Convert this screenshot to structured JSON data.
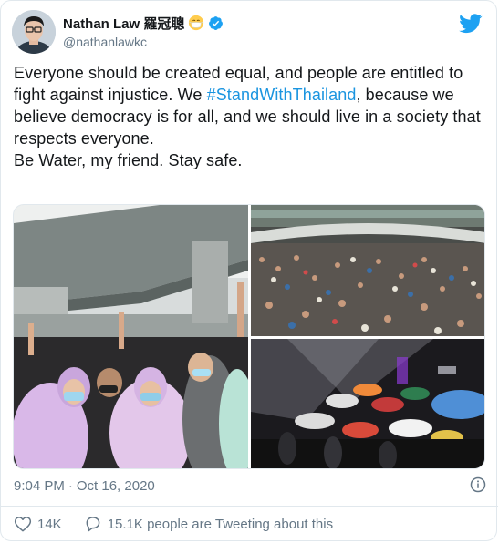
{
  "author": {
    "display_name": "Nathan Law 羅冠聰",
    "handle": "@nathanlawkc",
    "emoji_icon": "mask-face-emoji-icon",
    "verified_icon": "verified-badge-icon"
  },
  "brand": {
    "logo_icon": "twitter-bird-icon",
    "color": "#1da1f2"
  },
  "tweet": {
    "line1": "Everyone should be created equal, and people are entitled to fight against injustice. We ",
    "hashtag": "#StandWithThailand",
    "line1_rest": ", because we believe democracy is for all, and we should live in a society that respects everyone.",
    "line2": "Be Water, my friend. Stay safe.",
    "hashtag_color": "#1b95e0"
  },
  "meta": {
    "time": "9:04 PM",
    "separator": "·",
    "date": "Oct 16, 2020",
    "info_icon": "info-icon"
  },
  "actions": {
    "likes": "14K",
    "conversation": "15.1K people are Tweeting about this",
    "like_icon": "heart-icon",
    "reply_icon": "speech-bubble-icon"
  }
}
